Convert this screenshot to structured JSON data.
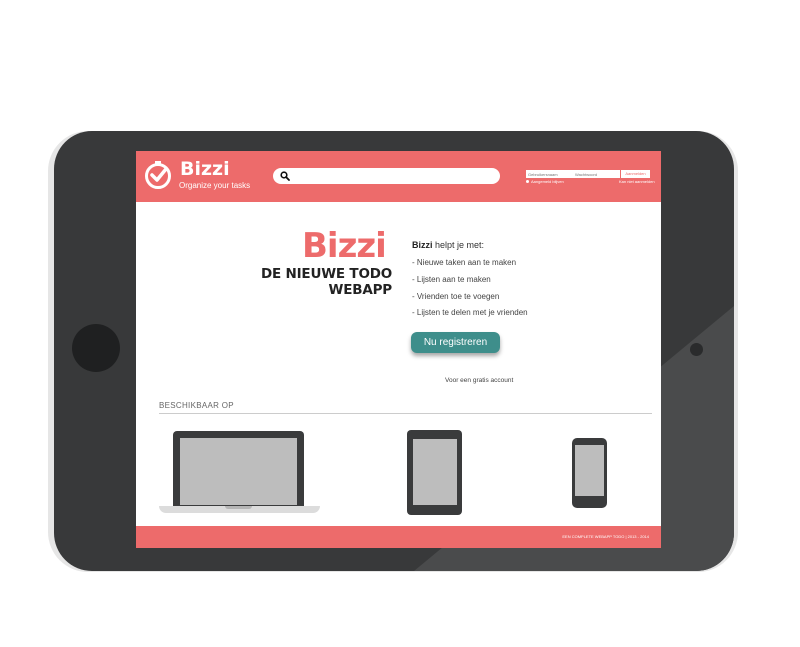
{
  "header": {
    "brand_name": "Bizzi",
    "tagline": "Organize your tasks",
    "login": {
      "username_placeholder": "Gebruikersnaam",
      "password_placeholder": "Wachtwoord",
      "submit_label": "Aanmelden",
      "remember_label": "Aangemeld blijven",
      "forgot_label": "Kan niet aanmelden"
    }
  },
  "hero": {
    "brand_name": "Bizzi",
    "title": "DE NIEUWE TODO WEBAPP",
    "intro_brand": "Bizzi",
    "intro_rest": " helpt je met:",
    "features": [
      "- Nieuwe taken aan te maken",
      "- Lijsten aan te maken",
      "- Vrienden toe te voegen",
      "- Lijsten te delen met je vrienden"
    ],
    "register_label": "Nu registreren",
    "free_account_label": "Voor een gratis account"
  },
  "availability": {
    "heading": "BESCHIKBAAR OP",
    "devices": [
      "laptop",
      "tablet",
      "phone"
    ]
  },
  "footer": {
    "text": "EEN COMPLETE WEBAPP TODO | 2013 - 2014"
  },
  "colors": {
    "brand": "#ed6b6b",
    "button": "#3e8e8b",
    "device_frame": "#38393a"
  }
}
